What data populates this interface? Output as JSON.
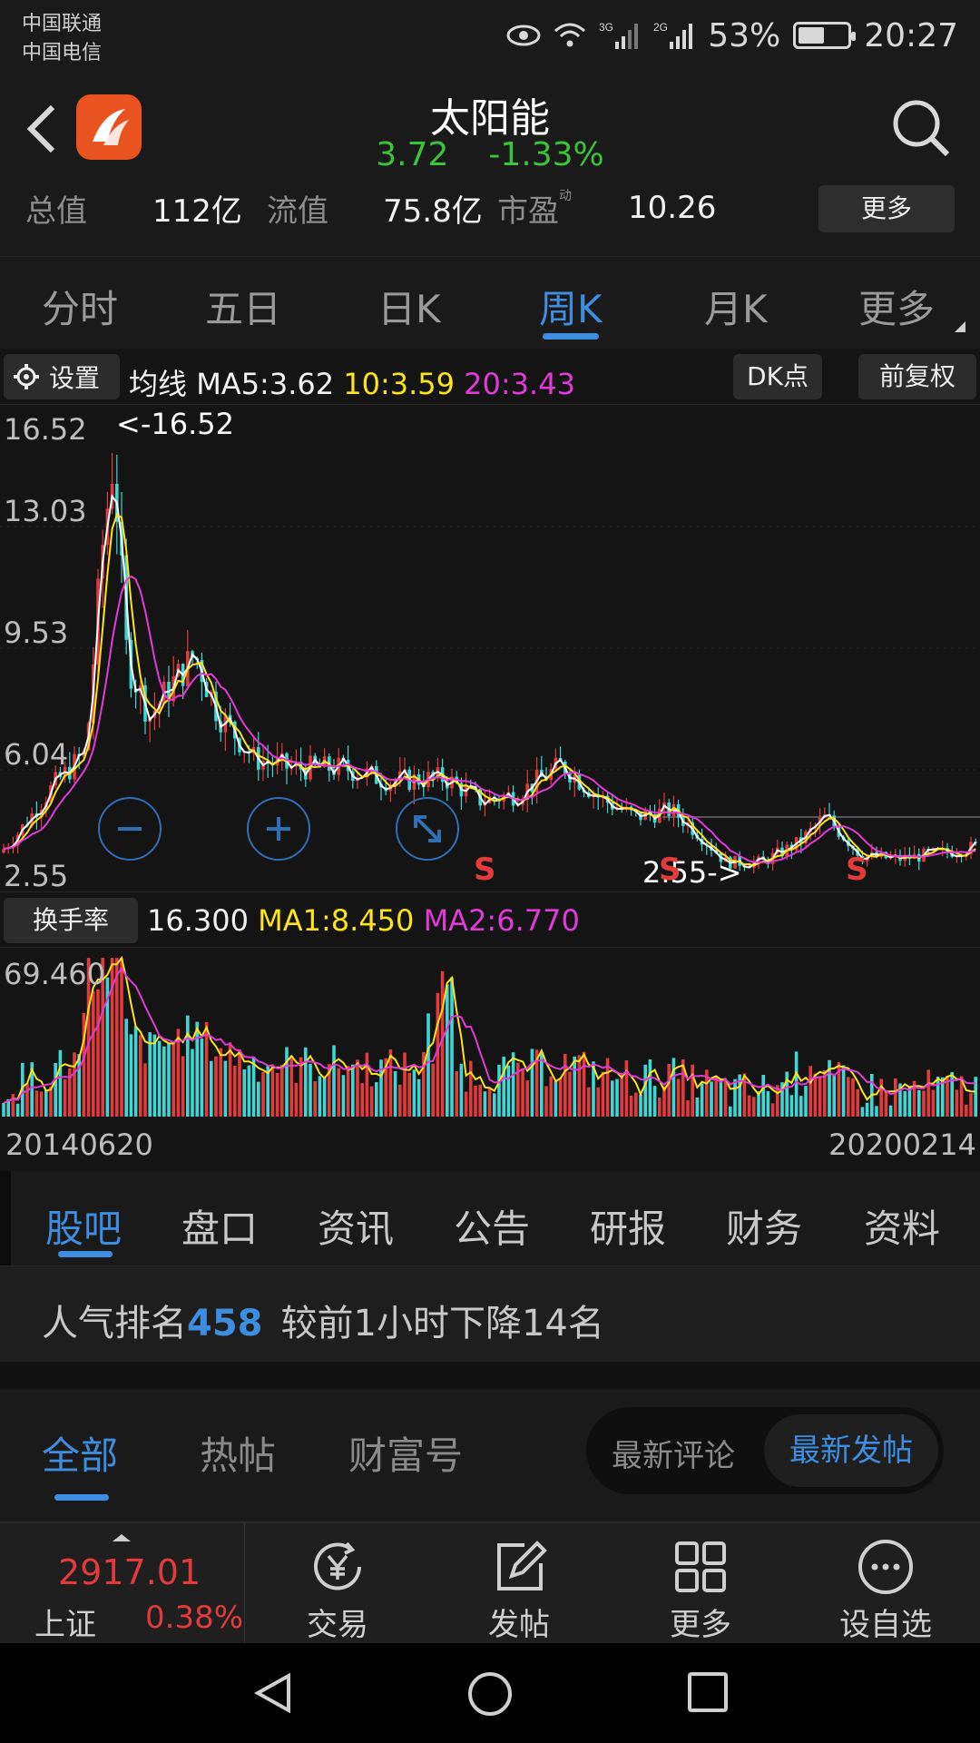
{
  "status_bar": {
    "carrier1": "中国联通",
    "carrier2": "中国电信",
    "net1": "3G",
    "net2": "2G",
    "battery": "53%",
    "battery_level": 0.53,
    "time": "20:27"
  },
  "header": {
    "stock_name": "太阳能",
    "price": "3.72",
    "change_pct": "-1.33%",
    "metrics": [
      {
        "label": "总值",
        "value": "112亿"
      },
      {
        "label": "流值",
        "value": "75.8亿"
      },
      {
        "label": "市盈",
        "sup": "动",
        "value": "10.26"
      }
    ],
    "more_label": "更多"
  },
  "period_tabs": [
    "分时",
    "五日",
    "日K",
    "周K",
    "月K",
    "更多"
  ],
  "active_period": "周K",
  "chart_toolbar": {
    "settings_label": "设置",
    "ma_label": "均线",
    "ma5": "MA5:3.62",
    "ma10": "10:3.59",
    "ma20": "20:3.43",
    "dk_label": "DK点",
    "adjust_label": "前复权"
  },
  "kline": {
    "y_ticks": [
      "16.52",
      "13.03",
      "9.53",
      "6.04",
      "2.55"
    ],
    "max_marker": "<-16.52",
    "min_marker": "2.55->",
    "signal": "S",
    "colors": {
      "up": "#e33a3a",
      "down": "#3fd6d6",
      "ma5": "#ffffff",
      "ma10": "#ffe41a",
      "ma20": "#e23ad9"
    }
  },
  "turnover": {
    "label": "换手率",
    "value": "16.300",
    "ma1": "MA1:8.450",
    "ma2": "MA2:6.770",
    "y_max": "69.460"
  },
  "dates": {
    "start": "20140620",
    "end": "20200214"
  },
  "section_tabs": [
    "股吧",
    "盘口",
    "资讯",
    "公告",
    "研报",
    "财务",
    "资料"
  ],
  "rank": {
    "prefix": "人气排名",
    "number": "458",
    "suffix": "较前1小时下降14名"
  },
  "filter_tabs": [
    "全部",
    "热帖",
    "财富号"
  ],
  "sort_options": {
    "a": "最新评论",
    "b": "最新发帖"
  },
  "bottom_nav": {
    "index_value": "2917.01",
    "index_name": "上证",
    "index_pct": "0.38%",
    "items": [
      "交易",
      "发帖",
      "更多",
      "设自选"
    ]
  }
}
